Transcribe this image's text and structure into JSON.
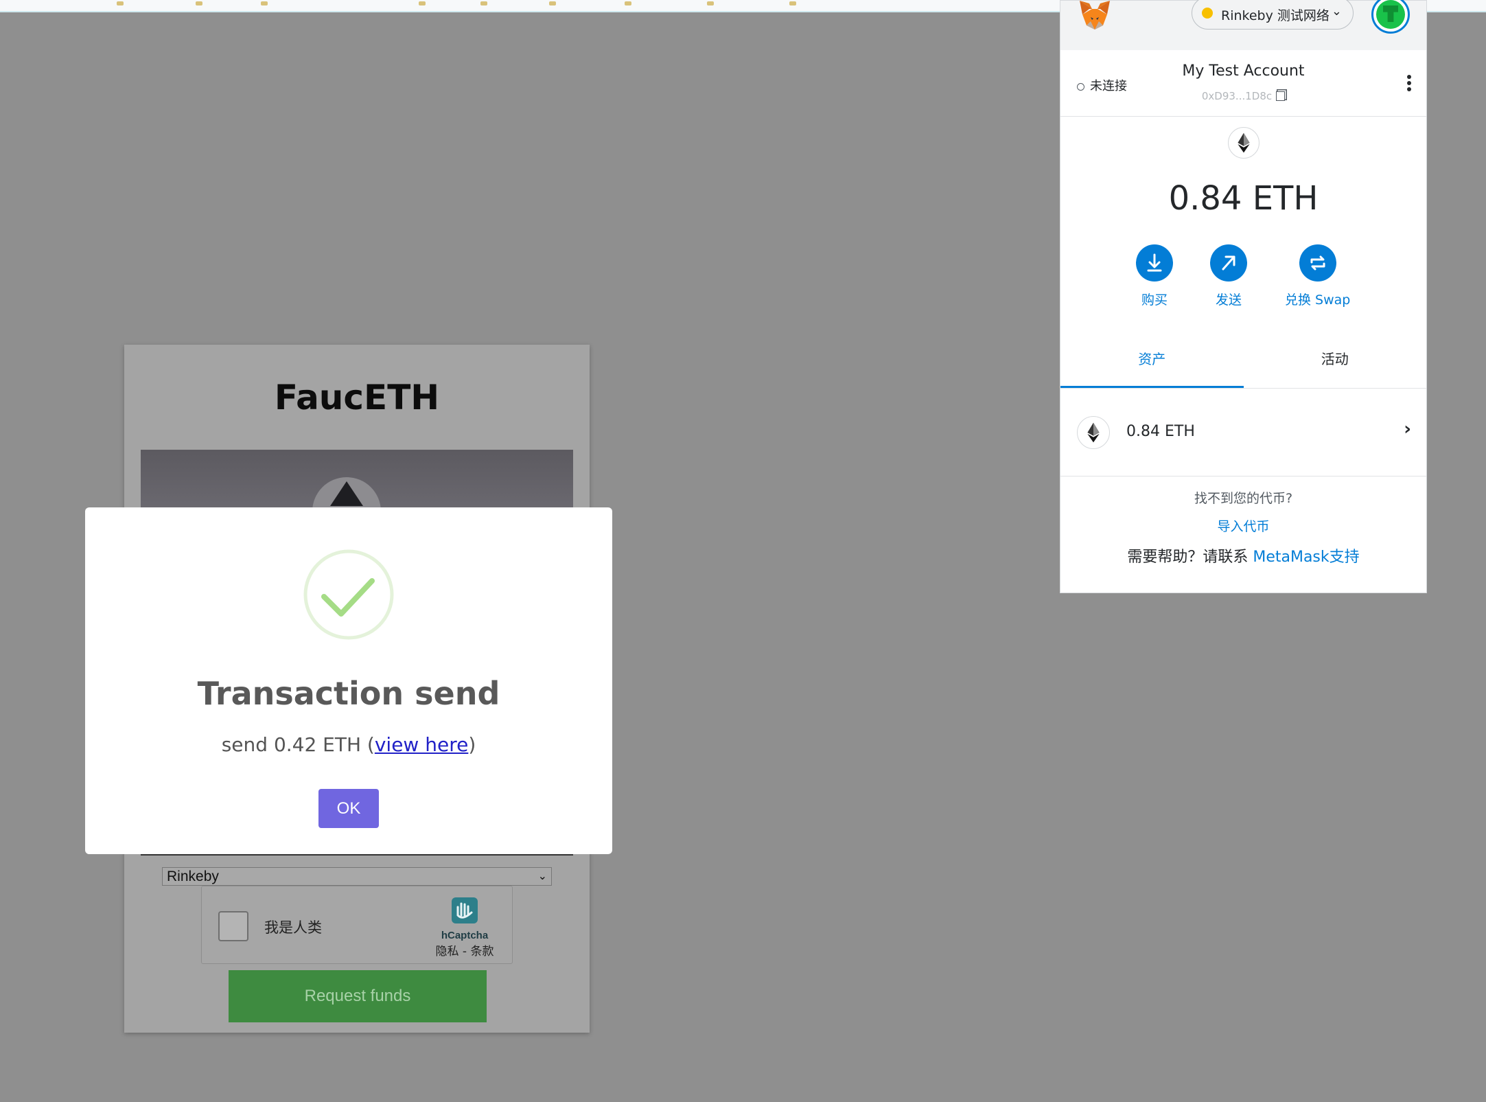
{
  "faucet": {
    "title": "FaucETH",
    "network_select": "Rinkeby",
    "captcha_label": "我是人类",
    "captcha_brand": "hCaptcha",
    "captcha_links": "隐私 - 条款",
    "request_button": "Request funds"
  },
  "modal": {
    "title": "Transaction send",
    "text_prefix": "send 0.42 ETH (",
    "link_text": "view here",
    "text_suffix": ")",
    "ok_button": "OK",
    "icon": "success-check-icon",
    "accent_color": "#7066e0"
  },
  "metamask": {
    "network": "Rinkeby 测试网络",
    "network_color": "#f8c000",
    "connection_status": "未连接",
    "account_name": "My Test Account",
    "account_address": "0xD93...1D8c",
    "balance": "0.84 ETH",
    "actions": [
      {
        "label": "购买",
        "icon": "download-icon"
      },
      {
        "label": "发送",
        "icon": "send-arrow-icon"
      },
      {
        "label": "兑换 Swap",
        "icon": "swap-icon"
      }
    ],
    "tabs": [
      "资产",
      "活动"
    ],
    "active_tab": "资产",
    "asset": {
      "name": "0.84 ETH"
    },
    "footer": {
      "question": "找不到您的代币?",
      "import_link": "导入代币",
      "help_prefix": "需要帮助？请联系 ",
      "help_link": "MetaMask支持"
    },
    "accent_color": "#037dd6"
  }
}
